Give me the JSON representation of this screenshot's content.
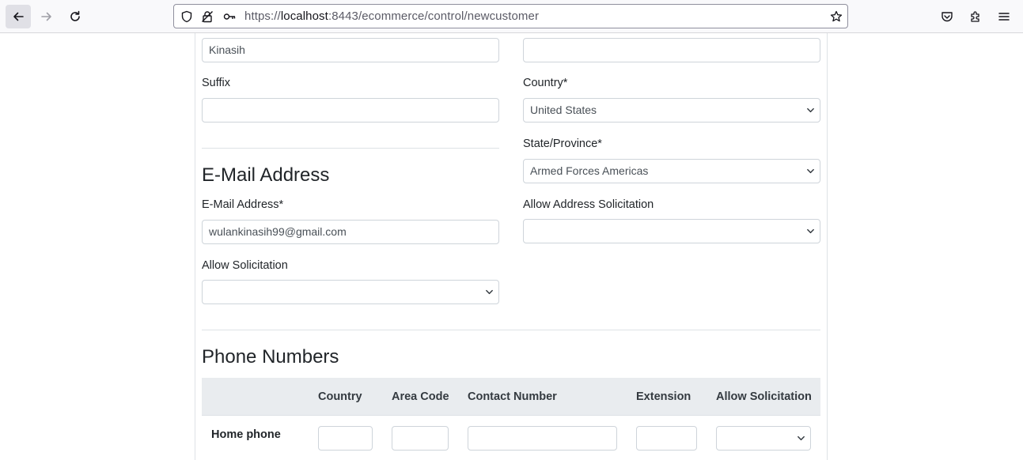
{
  "browser": {
    "url_prefix": "https://",
    "url_host": "localhost",
    "url_rest": ":8443/ecommerce/control/newcustomer"
  },
  "form": {
    "last_name_value": "Kinasih",
    "suffix_label": "Suffix",
    "suffix_value": "",
    "country_label": "Country*",
    "country_value": "United States",
    "state_label": "State/Province*",
    "state_value": "Armed Forces Americas",
    "allow_address_solicitation_label": "Allow Address Solicitation",
    "allow_address_solicitation_value": "",
    "email_section_title": "E-Mail Address",
    "email_label": "E-Mail Address*",
    "email_value": "wulankinasih99@gmail.com",
    "allow_solicitation_label": "Allow Solicitation",
    "allow_solicitation_value": ""
  },
  "phones": {
    "section_title": "Phone Numbers",
    "columns": [
      "",
      "Country",
      "Area Code",
      "Contact Number",
      "Extension",
      "Allow Solicitation"
    ],
    "rows": [
      {
        "label": "Home phone",
        "country": "",
        "area_code": "",
        "contact_number": "",
        "extension": "",
        "allow_solicitation": ""
      }
    ]
  }
}
